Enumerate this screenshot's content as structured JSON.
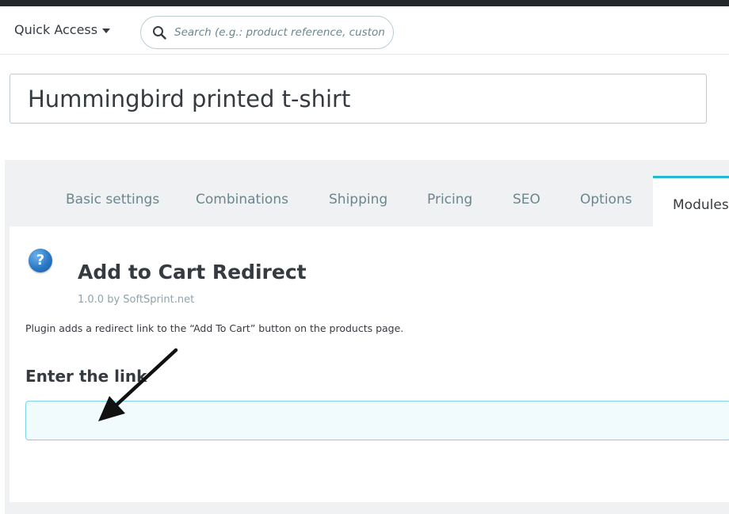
{
  "header": {
    "quick_access_label": "Quick Access",
    "search_placeholder": "Search (e.g.: product reference, custon",
    "search_icon": "search-icon"
  },
  "product": {
    "name": "Hummingbird printed t-shirt"
  },
  "tabs": [
    {
      "label": "Basic settings",
      "active": false
    },
    {
      "label": "Combinations",
      "active": false
    },
    {
      "label": "Shipping",
      "active": false
    },
    {
      "label": "Pricing",
      "active": false
    },
    {
      "label": "SEO",
      "active": false
    },
    {
      "label": "Options",
      "active": false
    },
    {
      "label": "Modules",
      "active": true
    }
  ],
  "module": {
    "icon": "help-icon",
    "help_glyph": "?",
    "title": "Add to Cart Redirect",
    "version": "1.0.0 by SoftSprint.net",
    "description": "Plugin adds a redirect link to the “Add To Cart” button on the products page.",
    "field_label": "Enter the link",
    "field_value": ""
  },
  "colors": {
    "accent": "#25b9d7",
    "topbar": "#25282b",
    "panel_bg": "#eff1f2"
  }
}
